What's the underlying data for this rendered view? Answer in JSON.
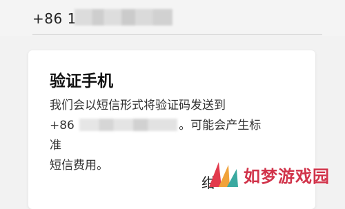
{
  "phone": {
    "prefix": "+86 1"
  },
  "dialog": {
    "title": "验证手机",
    "message_line1": "我们会以短信形式将验证码发送到",
    "message_prefix": "+86",
    "message_suffix": "。可能会产生标准",
    "message_line3": "短信费用。",
    "bottom_glyph": "绀"
  },
  "watermark": {
    "text": "如梦游戏园",
    "colors": [
      "#e23a4c",
      "#f0a23a",
      "#3aa9a0"
    ]
  }
}
